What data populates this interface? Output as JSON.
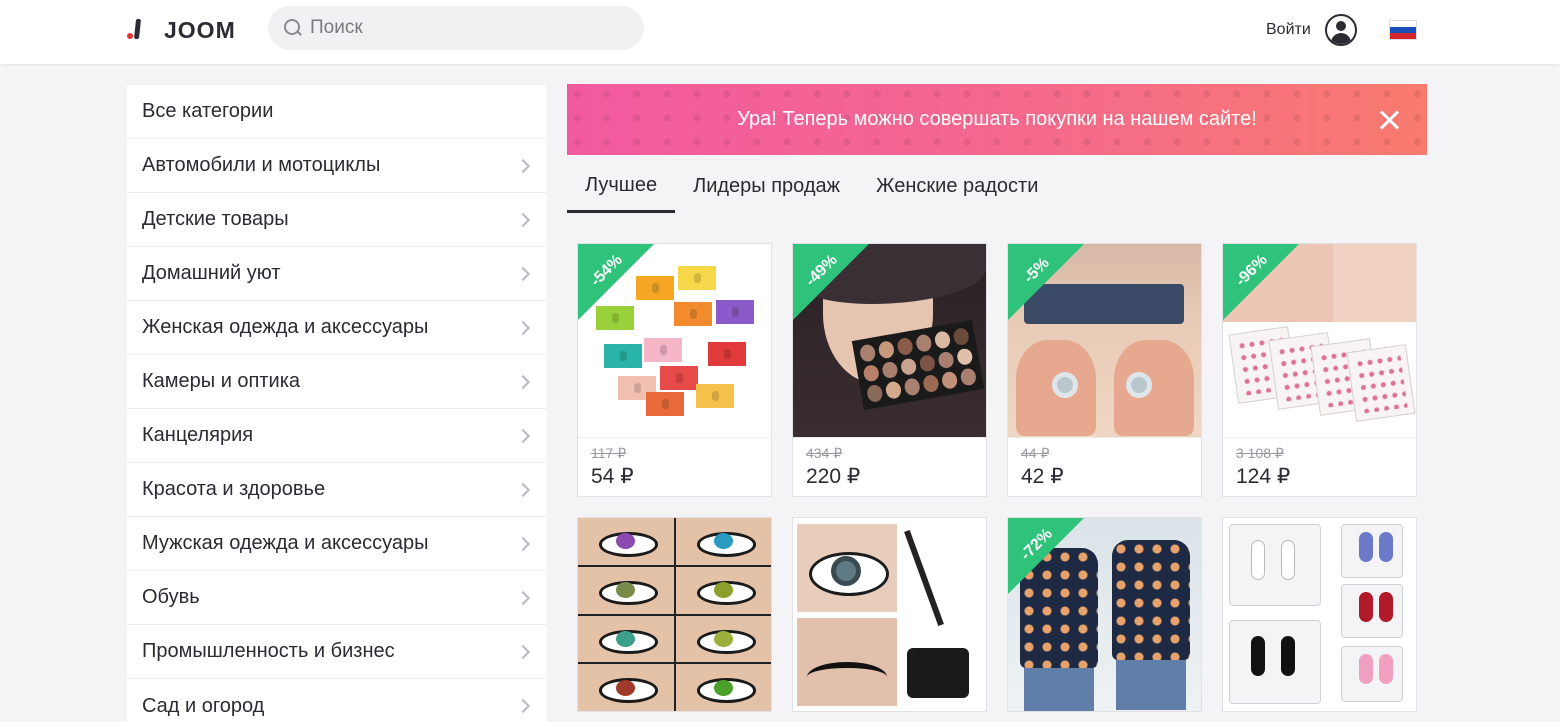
{
  "header": {
    "logo_text": "JOOM",
    "search_placeholder": "Поиск",
    "login_label": "Войти",
    "language_flag": "russia-flag"
  },
  "sidebar": {
    "items": [
      {
        "label": "Все категории",
        "has_arrow": false
      },
      {
        "label": "Автомобили и мотоциклы",
        "has_arrow": true
      },
      {
        "label": "Детские товары",
        "has_arrow": true
      },
      {
        "label": "Домашний уют",
        "has_arrow": true
      },
      {
        "label": "Женская одежда и аксессуары",
        "has_arrow": true
      },
      {
        "label": "Камеры и оптика",
        "has_arrow": true
      },
      {
        "label": "Канцелярия",
        "has_arrow": true
      },
      {
        "label": "Красота и здоровье",
        "has_arrow": true
      },
      {
        "label": "Мужская одежда и аксессуары",
        "has_arrow": true
      },
      {
        "label": "Обувь",
        "has_arrow": true
      },
      {
        "label": "Промышленность и бизнес",
        "has_arrow": true
      },
      {
        "label": "Сад и огород",
        "has_arrow": true
      }
    ]
  },
  "banner": {
    "text": "Ура! Теперь можно совершать покупки на нашем сайте!"
  },
  "tabs": [
    {
      "label": "Лучшее",
      "active": true
    },
    {
      "label": "Лидеры продаж",
      "active": false
    },
    {
      "label": "Женские радости",
      "active": false
    }
  ],
  "products": [
    {
      "discount": "-54%",
      "old_price": "117 ₽",
      "price": "54 ₽",
      "image": "hair-bows"
    },
    {
      "discount": "-49%",
      "old_price": "434 ₽",
      "price": "220 ₽",
      "image": "makeup-palette"
    },
    {
      "discount": "-5%",
      "old_price": "44 ₽",
      "price": "42 ₽",
      "image": "toe-rings"
    },
    {
      "discount": "-96%",
      "old_price": "3 108 ₽",
      "price": "124 ₽",
      "image": "nail-stickers"
    },
    {
      "discount": "",
      "old_price": "",
      "price": "",
      "image": "colored-lenses"
    },
    {
      "discount": "",
      "old_price": "",
      "price": "",
      "image": "eyeliner"
    },
    {
      "discount": "-72%",
      "old_price": "",
      "price": "",
      "image": "butterfly-tops"
    },
    {
      "discount": "",
      "old_price": "",
      "price": "",
      "image": "earphones"
    }
  ],
  "colors": {
    "accent_green": "#2fc27a",
    "banner_pink": "#f25aa0",
    "text_dark": "#2b2b33"
  }
}
